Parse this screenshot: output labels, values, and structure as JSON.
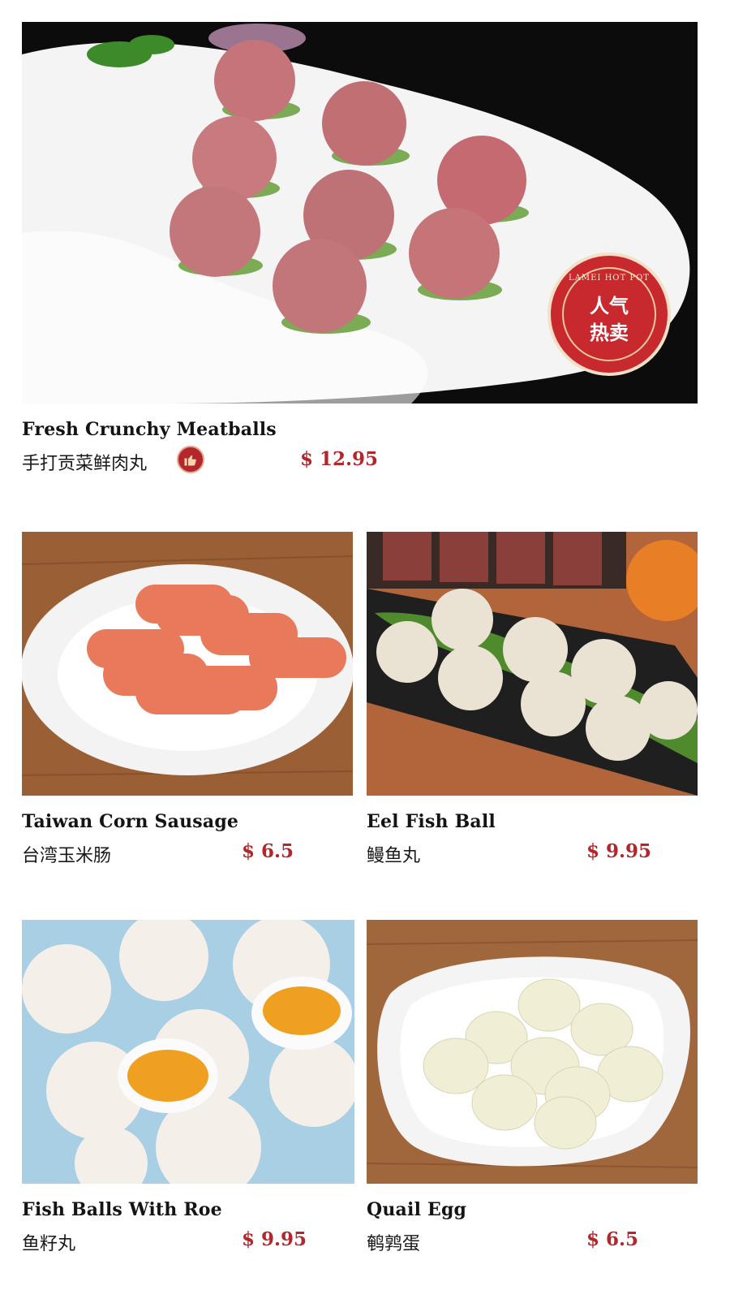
{
  "badge": {
    "ring_text": "LAMEI HOT POT",
    "line1": "人气",
    "line2": "热卖"
  },
  "items": [
    {
      "name_en": "Fresh Crunchy Meatballs",
      "name_cn": "手打贡菜鲜肉丸",
      "price": "$ 12.95",
      "recommended": true
    },
    {
      "name_en": "Taiwan Corn Sausage",
      "name_cn": "台湾玉米肠",
      "price": "$ 6.5"
    },
    {
      "name_en": "Eel Fish Ball",
      "name_cn": "鳗鱼丸",
      "price": "$ 9.95"
    },
    {
      "name_en": "Fish Balls With Roe",
      "name_cn": "鱼籽丸",
      "price": "$ 9.95"
    },
    {
      "name_en": "Quail Egg",
      "name_cn": "鹌鹑蛋",
      "price": "$ 6.5"
    }
  ],
  "colors": {
    "price": "#b3262b",
    "badge_red": "#b3262b",
    "badge_gold": "#e9c9a0"
  },
  "icons": [
    "thumbs-up-icon"
  ]
}
